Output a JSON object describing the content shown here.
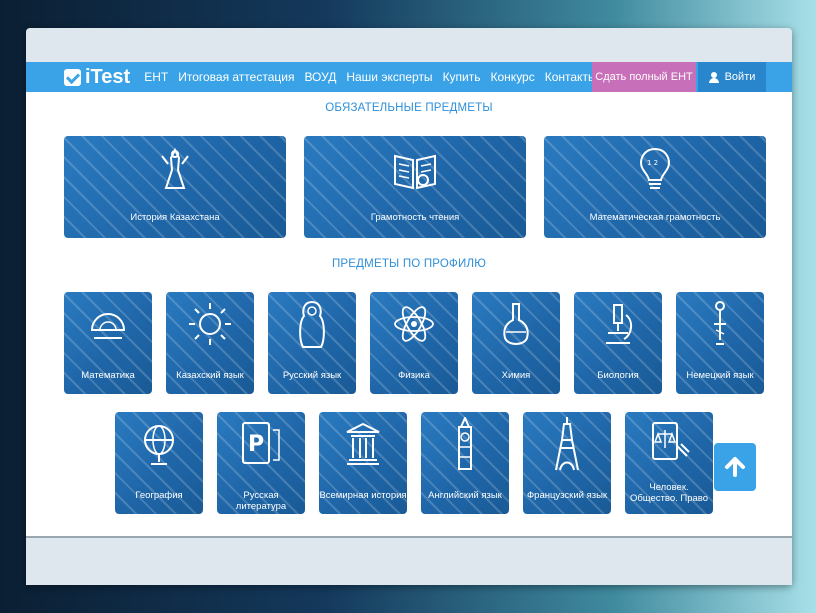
{
  "nav": {
    "logo": "iTest",
    "items": [
      "ЕНТ",
      "Итоговая аттестация",
      "ВОУД",
      "Наши эксперты",
      "Купить",
      "Конкурс",
      "Контакты"
    ],
    "cta": "Сдать полный ЕНТ",
    "login": "Войти"
  },
  "sections": {
    "required": "ОБЯЗАТЕЛЬНЫЕ ПРЕДМЕТЫ",
    "profile": "ПРЕДМЕТЫ ПО ПРОФИЛЮ"
  },
  "required_subjects": [
    {
      "label": "История Казахстана",
      "icon": "horseman-icon"
    },
    {
      "label": "Грамотность чтения",
      "icon": "book-icon"
    },
    {
      "label": "Математическая грамотность",
      "icon": "lightbulb-icon"
    }
  ],
  "profile_row1": [
    {
      "label": "Математика",
      "icon": "protractor-icon"
    },
    {
      "label": "Казахский язык",
      "icon": "sun-icon"
    },
    {
      "label": "Русский язык",
      "icon": "matryoshka-icon"
    },
    {
      "label": "Физика",
      "icon": "atom-icon"
    },
    {
      "label": "Химия",
      "icon": "flask-icon"
    },
    {
      "label": "Биология",
      "icon": "microscope-icon"
    },
    {
      "label": "Немецкий язык",
      "icon": "german-figure-icon"
    }
  ],
  "profile_row2": [
    {
      "label": "География",
      "icon": "globe-icon"
    },
    {
      "label": "Русская литература",
      "icon": "book-p-icon"
    },
    {
      "label": "Всемирная история",
      "icon": "temple-icon"
    },
    {
      "label": "Английский язык",
      "icon": "big-ben-icon"
    },
    {
      "label": "Французский язык",
      "icon": "eiffel-tower-icon"
    },
    {
      "label": "Человек. Общество. Право",
      "icon": "law-book-icon"
    }
  ],
  "colors": {
    "nav": "#3aa3e8",
    "cta": "#c86fb9",
    "card": "#1f66a8",
    "section_title": "#2e8fd8"
  },
  "scroll_top_icon": "arrow-up-icon"
}
